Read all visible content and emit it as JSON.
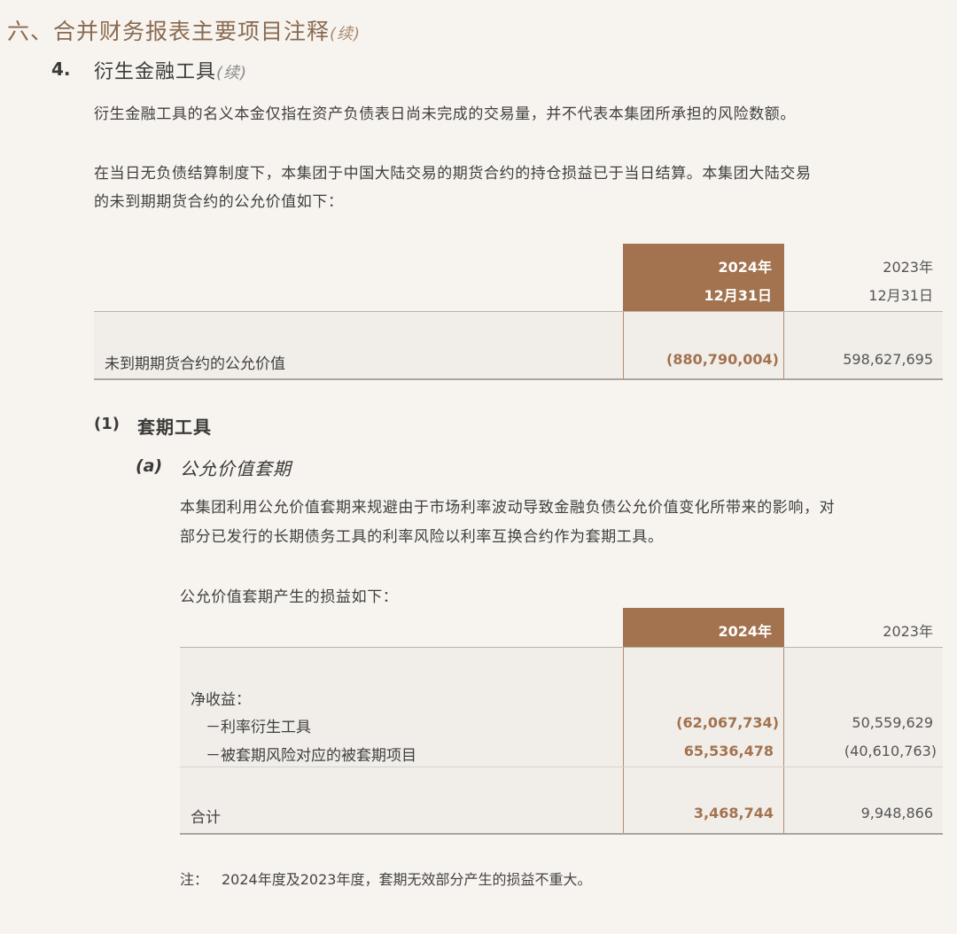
{
  "section": {
    "title": "六、合并财务报表主要项目注释",
    "cont": "(续)"
  },
  "subsection": {
    "num": "4.",
    "title": "衍生金融工具",
    "cont": "(续)"
  },
  "para1": "衍生金融工具的名义本金仅指在资产负债表日尚未完成的交易量，并不代表本集团所承担的风险数额。",
  "para2": {
    "line1": "在当日无负债结算制度下，本集团于中国大陆交易的期货合约的持仓损益已于当日结算。本集团大陆交易",
    "line2": "的未到期期货合约的公允价值如下："
  },
  "table1": {
    "header_cur": {
      "year": "2024年",
      "date": "12月31日"
    },
    "header_prev": {
      "year": "2023年",
      "date": "12月31日"
    },
    "row": {
      "label": "未到期期货合约的公允价值",
      "cur": "(880,790,004)",
      "prev": "598,627,695"
    }
  },
  "heading1": {
    "num": "(1)",
    "title": "套期工具"
  },
  "heading_a": {
    "num": "(a)",
    "title": "公允价值套期"
  },
  "para3": {
    "line1": "本集团利用公允价值套期来规避由于市场利率波动导致金融负债公允价值变化所带来的影响，对",
    "line2": "部分已发行的长期债务工具的利率风险以利率互换合约作为套期工具。"
  },
  "para4": "公允价值套期产生的损益如下：",
  "table2": {
    "header_cur": "2024年",
    "header_prev": "2023年",
    "group_label": "净收益：",
    "rows": [
      {
        "label": "－利率衍生工具",
        "cur": "(62,067,734)",
        "prev": "50,559,629"
      },
      {
        "label": "－被套期风险对应的被套期项目",
        "cur": "65,536,478",
        "prev": "(40,610,763)"
      }
    ],
    "total": {
      "label": "合计",
      "cur": "3,468,744",
      "prev": "9,948,866"
    }
  },
  "note": {
    "prefix": "注：",
    "text": "2024年度及2023年度，套期无效部分产生的损益不重大。"
  },
  "colors": {
    "accent": "#a3724f",
    "title": "#8a6a50",
    "background": "#f7f4ef"
  }
}
